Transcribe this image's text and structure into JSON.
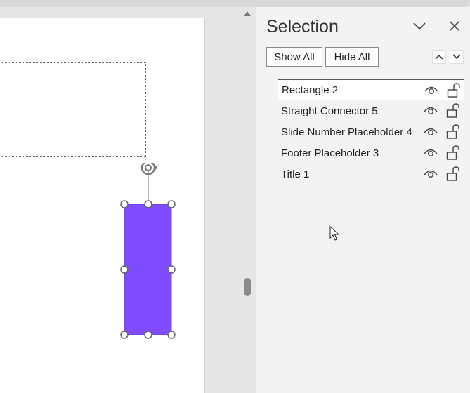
{
  "pane": {
    "title": "Selection",
    "show_all_label": "Show All",
    "hide_all_label": "Hide All",
    "items": [
      {
        "label": "Rectangle 2",
        "selected": true
      },
      {
        "label": "Straight Connector 5",
        "selected": false
      },
      {
        "label": "Slide Number Placeholder 4",
        "selected": false
      },
      {
        "label": "Footer Placeholder 3",
        "selected": false
      },
      {
        "label": "Title 1",
        "selected": false
      }
    ]
  },
  "colors": {
    "shape_fill": "#7f4cff",
    "pane_background": "#f3f3f3",
    "canvas_background": "#e6e6e6"
  }
}
